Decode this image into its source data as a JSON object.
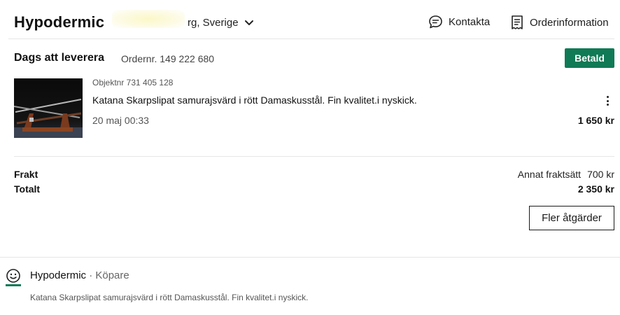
{
  "header": {
    "store_name": "Hypodermic",
    "location": "rg, Sverige",
    "contact_label": "Kontakta",
    "orderinfo_label": "Orderinformation"
  },
  "order": {
    "status_title": "Dags att leverera",
    "order_number": "Ordernr. 149 222 680",
    "paid_badge": "Betald"
  },
  "item": {
    "object_number": "Objektnr 731 405 128",
    "title": "Katana Skarpslipat samurajsvärd i rött Damaskusstål. Fin kvalitet.i nyskick.",
    "date": "20 maj 00:33",
    "price": "1 650 kr"
  },
  "totals": {
    "shipping_label": "Frakt",
    "shipping_method": "Annat fraktsätt",
    "shipping_price": "700 kr",
    "total_label": "Totalt",
    "total_price": "2 350 kr"
  },
  "actions": {
    "more_label": "Fler åtgärder"
  },
  "buyer": {
    "name": "Hypodermic",
    "role": " · Köpare",
    "item_title": "Katana Skarpslipat samurajsvärd i rött Damaskusstål. Fin kvalitet.i nyskick."
  },
  "colors": {
    "paid_badge": "#0f7a55",
    "avatar_accent": "#0f7a55"
  },
  "icons": {
    "location_toggle": "chevron-down-icon",
    "contact": "chat-bubble-icon",
    "orderinfo": "receipt-icon",
    "item_menu": "kebab-menu-icon",
    "buyer": "smiley-avatar-icon"
  }
}
